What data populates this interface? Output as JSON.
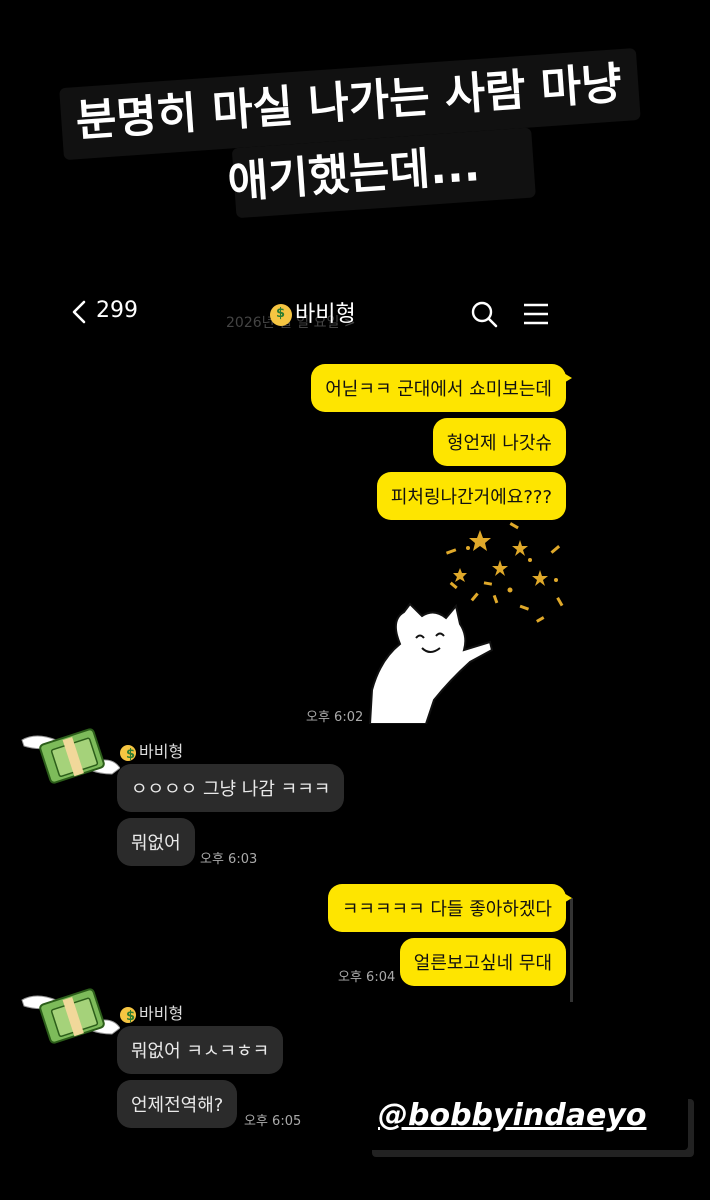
{
  "caption": {
    "line1": "분명히 마실 나가는 사람 마냥",
    "line2": "애기했는데..."
  },
  "header": {
    "back_count": "299",
    "title": "바비형",
    "date_ghost": "2026년 월 일 요일 >"
  },
  "messages_me_1": {
    "m1": "어닏ㅋㅋ 군대에서 쇼미보는데",
    "m2": "형언제 나갓슈",
    "m3": "피처링나간거에요???",
    "time": "오후 6:02"
  },
  "group_them_1": {
    "sender": "바비형",
    "m1": "ㅇㅇㅇㅇ 그냥 나감 ㅋㅋㅋ",
    "m2": "뭐없어",
    "time": "오후 6:03"
  },
  "messages_me_2": {
    "m1": "ㅋㅋㅋㅋㅋ 다들 좋아하겠다",
    "m2": "얼른보고싶네 무대",
    "time": "오후 6:04"
  },
  "group_them_2": {
    "sender": "바비형",
    "m1": "뭐없어 ㅋㅅㅋㅎㅋ",
    "m2": "언제전역해?",
    "time": "오후 6:05"
  },
  "handle": "@bobbyindaeyo",
  "colors": {
    "my_bubble": "#fee500",
    "their_bubble": "#2b2b2b",
    "background": "#000000"
  },
  "icons": [
    "back-chevron-icon",
    "search-icon",
    "menu-icon",
    "money-face-emoji-icon",
    "flying-money-avatar",
    "cat-sticker"
  ]
}
